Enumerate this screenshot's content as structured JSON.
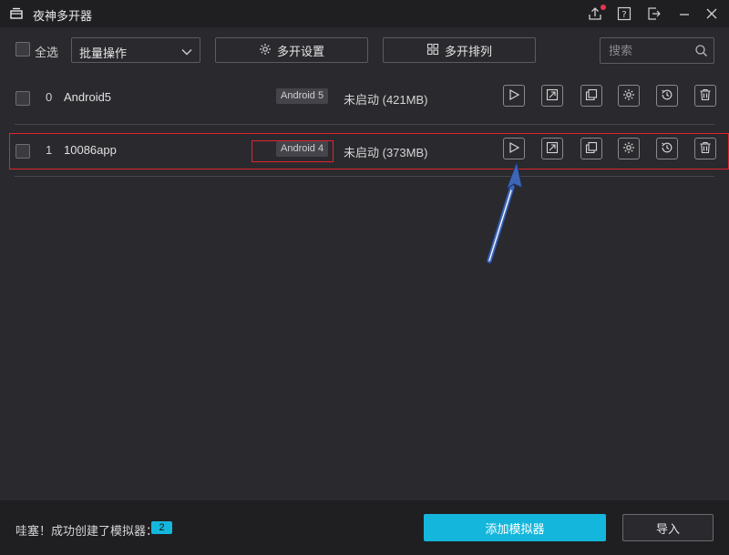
{
  "app": {
    "title": "夜神多开器"
  },
  "toolbar": {
    "select_all_label": "全选",
    "batch_dropdown_value": "批量操作",
    "multi_settings_label": "多开设置",
    "multi_arrange_label": "多开排列",
    "search_placeholder": "搜索"
  },
  "instances": [
    {
      "index": "0",
      "name": "Android5",
      "version": "Android 5",
      "status": "未启动 (421MB)"
    },
    {
      "index": "1",
      "name": "10086app",
      "version": "Android 4",
      "status": "未启动 (373MB)"
    }
  ],
  "footer": {
    "message": "哇塞！成功创建了模拟器：",
    "count": "2",
    "add_button": "添加模拟器",
    "import_button": "导入"
  },
  "colors": {
    "accent": "#15b6db",
    "highlight_box": "#e0242d",
    "arrow": "#3f66b5",
    "notification_dot": "#e8344e"
  },
  "icons": [
    "app-logo-icon",
    "upload-icon",
    "help-icon",
    "exit-icon",
    "minimize-icon",
    "close-icon",
    "settings-icon",
    "arrange-icon",
    "search-icon",
    "play-icon",
    "shortcut-icon",
    "copy-icon",
    "gear-icon",
    "backup-icon",
    "delete-icon"
  ]
}
